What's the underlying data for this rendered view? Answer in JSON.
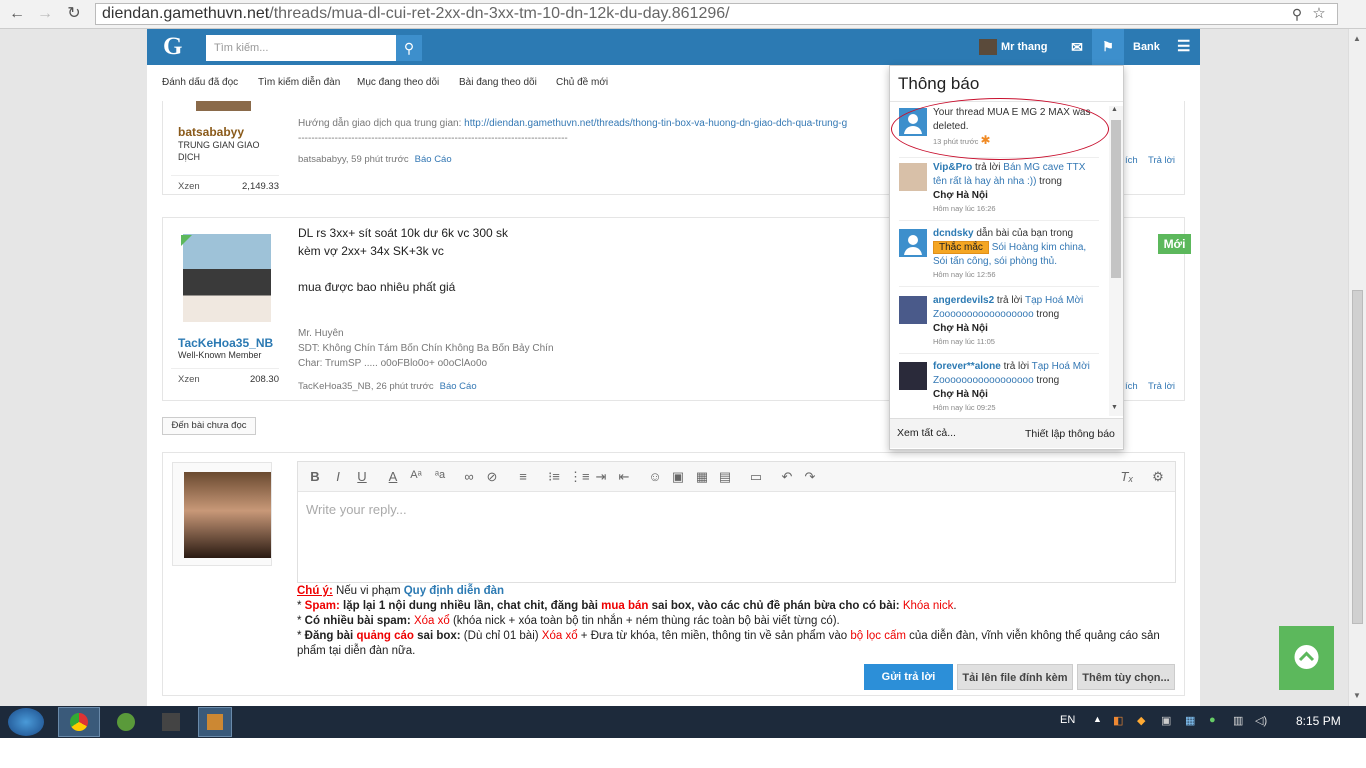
{
  "browser": {
    "url_host": "diendan.gamethuvn.net",
    "url_path": "/threads/mua-dl-cui-ret-2xx-dn-3xx-tm-10-dn-12k-du-day.861296/"
  },
  "topnav": {
    "logo": "G",
    "search_placeholder": "Tìm kiếm...",
    "username": "Mr thang",
    "bank_label": "Bank"
  },
  "subnav": {
    "items": [
      "Đánh dấu đã đọc",
      "Tìm kiếm diễn đàn",
      "Mục đang theo dõi",
      "Bài đang theo dõi",
      "Chủ đề mới"
    ]
  },
  "post1": {
    "username": "batsababyy",
    "usertitle": "TRUNG GIAN GIAO DỊCH",
    "xzen_label": "Xzen",
    "xzen_value": "2,149.33",
    "guide_text": "Hướng dẫn giao dịch qua trung gian: ",
    "guide_link": "http://diendan.gamethuvn.net/threads/thong-tin-box-va-huong-dn-giao-dch-qua-trung-g",
    "separator": "---------------------------------------------------------------------------------",
    "meta": "batsababyy, 59 phút trước",
    "report": "Báo Cáo",
    "right_like": "ích",
    "right_reply": "Trả lời"
  },
  "post2": {
    "username": "TacKeHoa35_NB",
    "usertitle": "Well-Known Member",
    "xzen_label": "Xzen",
    "xzen_value": "208.30",
    "line1": "DL rs 3xx+ sít soát 10k dư 6k vc 300 sk",
    "line2": "kèm vợ 2xx+ 34x SK+3k vc",
    "line3": "mua được bao nhiêu phất giá",
    "sig1": "Mr. Huyên",
    "sig2": "SDT: Không Chín Tám Bốn Chín Không Ba Bốn Bảy Chín",
    "sig3": "Char: TrumSP ..... o0oFBlo0o+ o0oClAo0o",
    "meta": "TacKeHoa35_NB, 26 phút trước",
    "report": "Báo Cáo",
    "new_badge": "Mới",
    "right_like": "ích",
    "right_reply": "Trả lời"
  },
  "unread_button": "Đến bài chưa đọc",
  "reply": {
    "placeholder": "Write your reply...",
    "rules_note": "Chú ý:",
    "rules_intro": " Nếu vi phạm ",
    "rules_link": "Quy định diễn đàn",
    "rule1_a": "* ",
    "rule1_b": "Spam:",
    "rule1_c": " lặp lại 1 nội dung nhiều lần, chat chit, đăng bài ",
    "rule1_d": "mua bán",
    "rule1_e": " sai box, vào các chủ đề phán bừa cho có bài: ",
    "rule1_f": "Khóa nick",
    "rule1_g": ".",
    "rule2_a": "* ",
    "rule2_b": "Có nhiều bài spam:",
    "rule2_c": " Xóa xổ",
    "rule2_d": " (khóa nick + xóa toàn bộ tin nhắn + ném thùng rác toàn bộ bài viết từng có).",
    "rule3_a": "* ",
    "rule3_b": "Đăng bài ",
    "rule3_c": "quảng cáo",
    "rule3_d": " sai box:",
    "rule3_e": " (Dù chỉ 01 bài) ",
    "rule3_f": "Xóa xổ",
    "rule3_g": " + Đưa từ khóa, tên miền, thông tin về sản phẩm vào ",
    "rule3_h": "bộ lọc cấm",
    "rule3_i": " của diễn đàn, vĩnh viễn không thể quảng cáo sản phẩm tại diễn đàn nữa.",
    "submit": "Gửi trả lời",
    "upload": "Tải lên file đính kèm",
    "more": "Thêm tùy chọn..."
  },
  "notifications": {
    "title": "Thông báo",
    "items": [
      {
        "text": "Your thread MUA E MG 2 MAX was deleted.",
        "time": "13 phút trước"
      },
      {
        "user": "Vip&Pro",
        "verb": " trả lời ",
        "link": "Bán MG cave TTX tên rất là hay àh nha :))",
        "mid": " trong ",
        "forum": "Chợ Hà Nội",
        "time": "Hôm nay lúc 16:26"
      },
      {
        "user": "dcndsky",
        "verb": " dẫn bài của bạn trong ",
        "tag": "Thắc mắc",
        "link": "Sói Hoàng kim china, Sói tấn công, sói phòng thủ.",
        "time": "Hôm nay lúc 12:56"
      },
      {
        "user": "angerdevils2",
        "verb": " trả lời ",
        "link": "Tạp Hoá Mời Zooooooooooooooooo",
        "mid": " trong ",
        "forum": "Chợ Hà Nội",
        "time": "Hôm nay lúc 11:05"
      },
      {
        "user": "forever**alone",
        "verb": " trả lời ",
        "link": "Tạp Hoá Mời Zooooooooooooooooo",
        "mid": " trong ",
        "forum": "Chợ Hà Nội",
        "time": "Hôm nay lúc 09:25"
      }
    ],
    "see_all": "Xem tất cả...",
    "settings": "Thiết lập thông báo"
  },
  "taskbar": {
    "lang": "EN",
    "clock": "8:15 PM"
  }
}
